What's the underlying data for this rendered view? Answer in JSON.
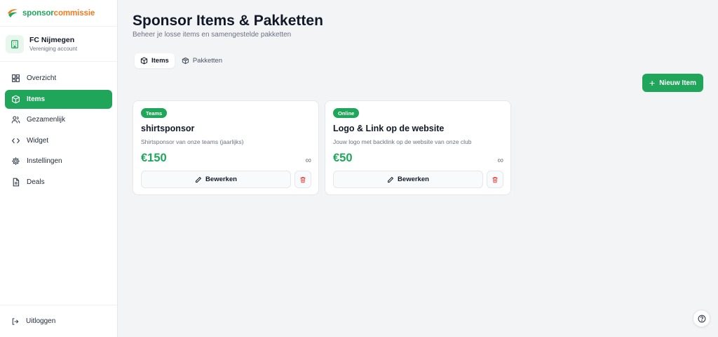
{
  "brand": {
    "part1": "sponsor",
    "part2": "commissie",
    "primary": "#1fa65a",
    "secondary": "#f07a22"
  },
  "account": {
    "name": "FC Nijmegen",
    "subtitle": "Vereniging account",
    "icon": "building-icon"
  },
  "sidebar": {
    "items": [
      {
        "label": "Overzicht",
        "icon": "dashboard-icon",
        "active": false
      },
      {
        "label": "Items",
        "icon": "box-icon",
        "active": true
      },
      {
        "label": "Gezamenlijk",
        "icon": "users-icon",
        "active": false
      },
      {
        "label": "Widget",
        "icon": "code-icon",
        "active": false
      },
      {
        "label": "Instellingen",
        "icon": "gear-icon",
        "active": false
      },
      {
        "label": "Deals",
        "icon": "document-icon",
        "active": false
      }
    ],
    "logout_label": "Uitloggen"
  },
  "header": {
    "title": "Sponsor Items & Pakketten",
    "subtitle": "Beheer je losse items en samengestelde pakketten"
  },
  "tabs": [
    {
      "label": "Items",
      "icon": "box-icon",
      "active": true
    },
    {
      "label": "Pakketten",
      "icon": "package-icon",
      "active": false
    }
  ],
  "new_item_button": {
    "label": "Nieuw Item",
    "icon": "plus-icon"
  },
  "cards": [
    {
      "badge": "Teams",
      "title": "shirtsponsor",
      "description": "Shirtsponsor van onze teams (jaarlijks)",
      "price": "€150",
      "quantity": "∞",
      "edit_label": "Bewerken"
    },
    {
      "badge": "Online",
      "title": "Logo & Link op de website",
      "description": "Jouw logo met backlink op de website van onze club",
      "price": "€50",
      "quantity": "∞",
      "edit_label": "Bewerken"
    }
  ]
}
